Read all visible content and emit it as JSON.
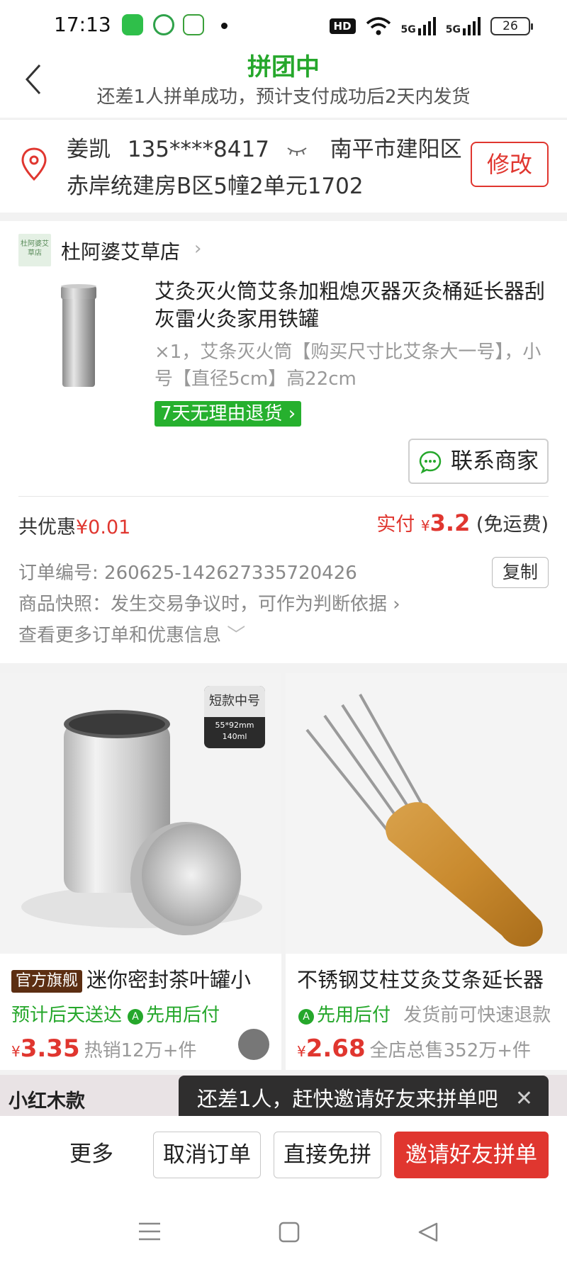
{
  "status_bar": {
    "time": "17:13",
    "hd": "HD",
    "net1": "5G",
    "net2": "5G",
    "battery": "26"
  },
  "header": {
    "title": "拼团中",
    "subtitle": "还差1人拼单成功，预计支付成功后2天内发货"
  },
  "address": {
    "name": "姜凯",
    "phone": "135****8417",
    "region": "南平市建阳区",
    "detail": "赤岸统建房B区5幢2单元1702",
    "modify_label": "修改"
  },
  "shop": {
    "logo_text": "杜阿婆艾草店",
    "name": "杜阿婆艾草店"
  },
  "product": {
    "title": "艾灸灭火筒艾条加粗熄灭器灭灸桶延长器刮灰雷火灸家用铁罐",
    "spec": "×1，艾条灭火筒【购买尺寸比艾条大一号】，小号【直径5cm】高22cm",
    "refund_tag": "7天无理由退货",
    "contact_label": "联系商家"
  },
  "summary": {
    "discount_label": "共优惠",
    "discount_value": "¥0.01",
    "paid_label": "实付",
    "paid_currency": "¥",
    "paid_amount": "3.2",
    "shipping_note": "(免运费)"
  },
  "order_info": {
    "order_no_label": "订单编号:",
    "order_no": "260625-142627335720426",
    "copy_label": "复制",
    "snapshot_text": "商品快照：发生交易争议时，可作为判断依据",
    "more_text": "查看更多订单和优惠信息"
  },
  "recommendations": [
    {
      "image_badge": "短款中号",
      "image_badge_sub": "55*92mm\n140ml",
      "brand_tag": "官方旗舰",
      "title": "迷你密封茶叶罐小",
      "tag1": "预计后天送达",
      "tag2": "先用后付",
      "currency": "¥",
      "price": "3.35",
      "sales": "热销12万+件"
    },
    {
      "title": "不锈钢艾柱艾灸艾条延长器",
      "tag1": "先用后付",
      "tag2": "发货前可快速退款",
      "currency": "¥",
      "price": "2.68",
      "sales": "全店总售352万+件"
    }
  ],
  "strip_label": "小红木款",
  "tooltip": {
    "text": "还差1人，赶快邀请好友来拼单吧"
  },
  "bottom_bar": {
    "more_label": "更多",
    "cancel_label": "取消订单",
    "free_label": "直接免拼",
    "invite_label": "邀请好友拼单"
  },
  "colors": {
    "brand_green": "#25a72b",
    "accent_red": "#e0362f"
  }
}
